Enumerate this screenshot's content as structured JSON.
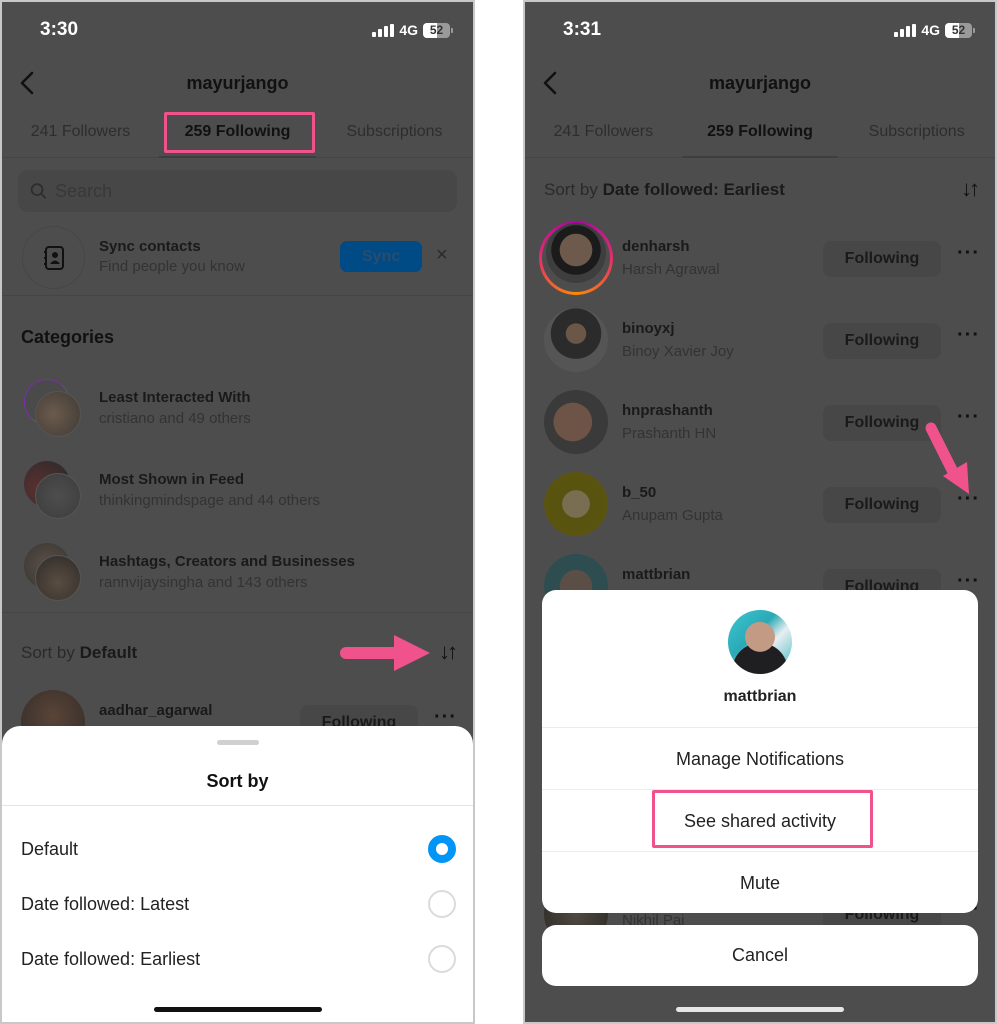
{
  "left": {
    "status": {
      "time": "3:30",
      "network": "4G",
      "battery": "52"
    },
    "nav": {
      "title": "mayurjango"
    },
    "tabs": [
      {
        "label": "241 Followers",
        "active": false
      },
      {
        "label": "259 Following",
        "active": true
      },
      {
        "label": "Subscriptions",
        "active": false
      }
    ],
    "search": {
      "placeholder": "Search"
    },
    "sync": {
      "title": "Sync contacts",
      "subtitle": "Find people you know",
      "button": "Sync",
      "close": "×"
    },
    "categories": {
      "heading": "Categories",
      "items": [
        {
          "title": "Least Interacted With",
          "subtitle": "cristiano and 49 others"
        },
        {
          "title": "Most Shown in Feed",
          "subtitle": "thinkingmindspage and 44 others"
        },
        {
          "title": "Hashtags, Creators and Businesses",
          "subtitle": "rannvijaysingha and 143 others"
        }
      ]
    },
    "sort": {
      "prefix": "Sort by",
      "value": "Default",
      "icon": "↓↑"
    },
    "users": [
      {
        "username": "aadhar_agarwal",
        "button": "Following",
        "more": "···"
      }
    ],
    "sheet": {
      "title": "Sort by",
      "options": [
        {
          "label": "Default",
          "selected": true
        },
        {
          "label": "Date followed: Latest",
          "selected": false
        },
        {
          "label": "Date followed: Earliest",
          "selected": false
        }
      ]
    }
  },
  "right": {
    "status": {
      "time": "3:31",
      "network": "4G",
      "battery": "52"
    },
    "nav": {
      "title": "mayurjango"
    },
    "tabs": [
      {
        "label": "241 Followers",
        "active": false
      },
      {
        "label": "259 Following",
        "active": true
      },
      {
        "label": "Subscriptions",
        "active": false
      }
    ],
    "sort": {
      "prefix": "Sort by",
      "value": "Date followed: Earliest",
      "icon": "↓↑"
    },
    "users": [
      {
        "username": "denharsh",
        "fullname": "Harsh Agrawal",
        "button": "Following",
        "more": "···"
      },
      {
        "username": "binoyxj",
        "fullname": "Binoy Xavier Joy",
        "button": "Following",
        "more": "···"
      },
      {
        "username": "hnprashanth",
        "fullname": "Prashanth HN",
        "button": "Following",
        "more": "···"
      },
      {
        "username": "b_50",
        "fullname": "Anupam Gupta",
        "button": "Following",
        "more": "···"
      },
      {
        "username": "mattbrian",
        "fullname": "",
        "button": "Following",
        "more": "···"
      },
      {
        "username": "",
        "fullname": "Nikhil Pai",
        "button": "Following",
        "more": "···"
      }
    ],
    "action_sheet": {
      "username": "mattbrian",
      "items": [
        "Manage Notifications",
        "See shared activity",
        "Mute"
      ],
      "cancel": "Cancel"
    }
  },
  "annotation_color": "#f0538c"
}
